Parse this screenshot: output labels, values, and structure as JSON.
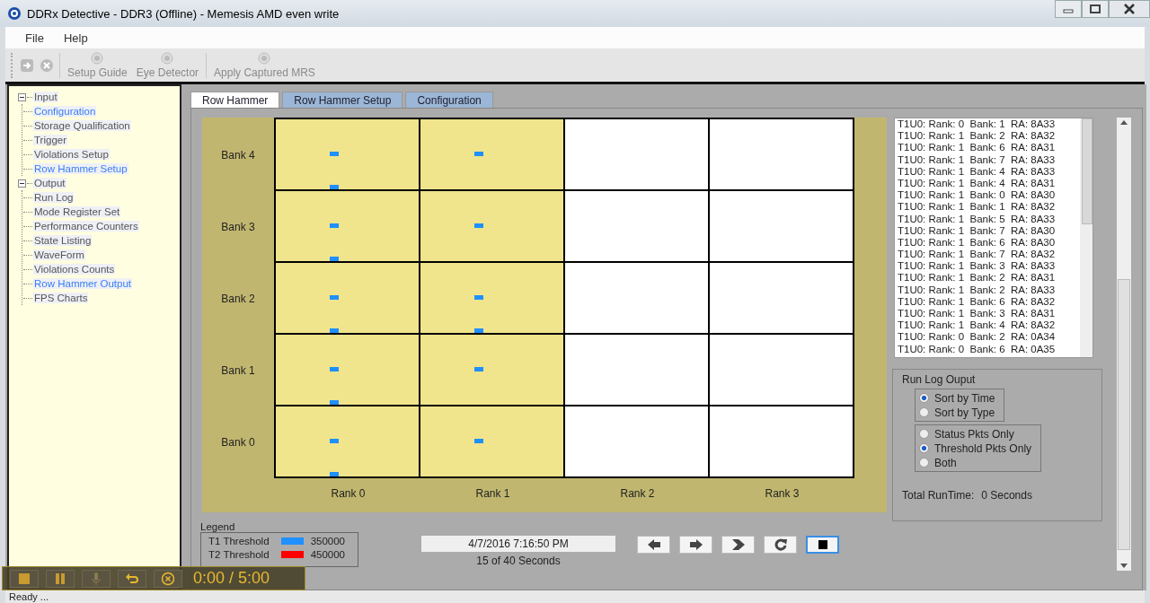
{
  "window": {
    "title": "DDRx Detective - DDR3 (Offline) - Memesis AMD even write"
  },
  "menu": [
    "File",
    "Help"
  ],
  "toolbar": {
    "icon_buttons": [
      {
        "disabled": true
      },
      {
        "disabled": true
      }
    ],
    "buttons": [
      {
        "label": "Setup Guide",
        "disabled": true
      },
      {
        "label": "Eye Detector",
        "disabled": true
      },
      {
        "label": "Apply Captured MRS",
        "disabled": true
      }
    ]
  },
  "tree": [
    {
      "label": "Input",
      "expanded": true,
      "children": [
        {
          "label": "Configuration",
          "highlighted": true
        },
        {
          "label": "Storage Qualification",
          "highlighted": false
        },
        {
          "label": "Trigger",
          "highlighted": false
        },
        {
          "label": "Violations Setup",
          "highlighted": false
        },
        {
          "label": "Row Hammer Setup",
          "highlighted": true
        }
      ]
    },
    {
      "label": "Output",
      "expanded": true,
      "children": [
        {
          "label": "Run Log",
          "highlighted": false
        },
        {
          "label": "Mode Register Set",
          "highlighted": false
        },
        {
          "label": "Performance Counters",
          "highlighted": false
        },
        {
          "label": "State Listing",
          "highlighted": false
        },
        {
          "label": "WaveForm",
          "highlighted": false
        },
        {
          "label": "Violations Counts",
          "highlighted": false
        },
        {
          "label": "Row Hammer Output",
          "highlighted": true
        },
        {
          "label": "FPS Charts",
          "highlighted": false
        }
      ]
    }
  ],
  "tabs": [
    {
      "label": "Row Hammer",
      "selected": true
    },
    {
      "label": "Row Hammer Setup",
      "selected": false
    },
    {
      "label": "Configuration",
      "selected": false
    }
  ],
  "grid": {
    "banks": [
      {
        "label": "Bank 4",
        "cells": [
          {
            "active": true,
            "t1_center": true,
            "t1_bottom": true
          },
          {
            "active": true,
            "t1_center": true,
            "t1_bottom": false
          },
          {
            "active": false,
            "t1_center": false,
            "t1_bottom": false
          },
          {
            "active": false,
            "t1_center": false,
            "t1_bottom": false
          }
        ]
      },
      {
        "label": "Bank 3",
        "cells": [
          {
            "active": true,
            "t1_center": true,
            "t1_bottom": true
          },
          {
            "active": true,
            "t1_center": true,
            "t1_bottom": false
          },
          {
            "active": false,
            "t1_center": false,
            "t1_bottom": false
          },
          {
            "active": false,
            "t1_center": false,
            "t1_bottom": false
          }
        ]
      },
      {
        "label": "Bank 2",
        "cells": [
          {
            "active": true,
            "t1_center": true,
            "t1_bottom": true
          },
          {
            "active": true,
            "t1_center": true,
            "t1_bottom": true
          },
          {
            "active": false,
            "t1_center": false,
            "t1_bottom": false
          },
          {
            "active": false,
            "t1_center": false,
            "t1_bottom": false
          }
        ]
      },
      {
        "label": "Bank 1",
        "cells": [
          {
            "active": true,
            "t1_center": true,
            "t1_bottom": true
          },
          {
            "active": true,
            "t1_center": true,
            "t1_bottom": false
          },
          {
            "active": false,
            "t1_center": false,
            "t1_bottom": false
          },
          {
            "active": false,
            "t1_center": false,
            "t1_bottom": false
          }
        ]
      },
      {
        "label": "Bank 0",
        "cells": [
          {
            "active": true,
            "t1_center": true,
            "t1_bottom": true
          },
          {
            "active": true,
            "t1_center": true,
            "t1_bottom": false
          },
          {
            "active": false,
            "t1_center": false,
            "t1_bottom": false
          },
          {
            "active": false,
            "t1_center": false,
            "t1_bottom": false
          }
        ]
      }
    ],
    "ranks": [
      "Rank 0",
      "Rank 1",
      "Rank 2",
      "Rank 3"
    ]
  },
  "log": [
    "T1U0: Rank: 0  Bank: 1  RA: 8A33",
    "T1U0: Rank: 1  Bank: 2  RA: 8A32",
    "T1U0: Rank: 1  Bank: 6  RA: 8A31",
    "T1U0: Rank: 1  Bank: 7  RA: 8A33",
    "T1U0: Rank: 1  Bank: 4  RA: 8A33",
    "T1U0: Rank: 1  Bank: 4  RA: 8A31",
    "T1U0: Rank: 1  Bank: 0  RA: 8A30",
    "T1U0: Rank: 1  Bank: 1  RA: 8A32",
    "T1U0: Rank: 1  Bank: 5  RA: 8A33",
    "T1U0: Rank: 1  Bank: 7  RA: 8A30",
    "T1U0: Rank: 1  Bank: 6  RA: 8A30",
    "T1U0: Rank: 1  Bank: 7  RA: 8A32",
    "T1U0: Rank: 1  Bank: 3  RA: 8A33",
    "T1U0: Rank: 1  Bank: 2  RA: 8A31",
    "T1U0: Rank: 1  Bank: 2  RA: 8A33",
    "T1U0: Rank: 1  Bank: 6  RA: 8A32",
    "T1U0: Rank: 1  Bank: 3  RA: 8A31",
    "T1U0: Rank: 1  Bank: 4  RA: 8A32",
    "T1U0: Rank: 0  Bank: 2  RA: 0A34",
    "T1U0: Rank: 0  Bank: 6  RA: 0A35"
  ],
  "run_log": {
    "title": "Run Log Ouput",
    "sort_options": [
      {
        "label": "Sort by Time",
        "selected": true
      },
      {
        "label": "Sort by Type",
        "selected": false
      }
    ],
    "packet_options": [
      {
        "label": "Status Pkts Only",
        "selected": false
      },
      {
        "label": "Threshold Pkts Only",
        "selected": true
      },
      {
        "label": "Both",
        "selected": false
      }
    ],
    "total_label": "Total RunTime:",
    "total_value": "0 Seconds"
  },
  "legend": {
    "title": "Legend",
    "items": [
      {
        "label": "T1 Threshold",
        "color": "#1e90ff",
        "value": "350000"
      },
      {
        "label": "T2 Threshold",
        "color": "#ff0000",
        "value": "450000"
      }
    ]
  },
  "playback": {
    "timestamp": "4/7/2016 7:16:50 PM",
    "progress": "15 of 40 Seconds"
  },
  "recorder": {
    "time": "0:00 / 5:00"
  },
  "status_bar": "Ready ..."
}
